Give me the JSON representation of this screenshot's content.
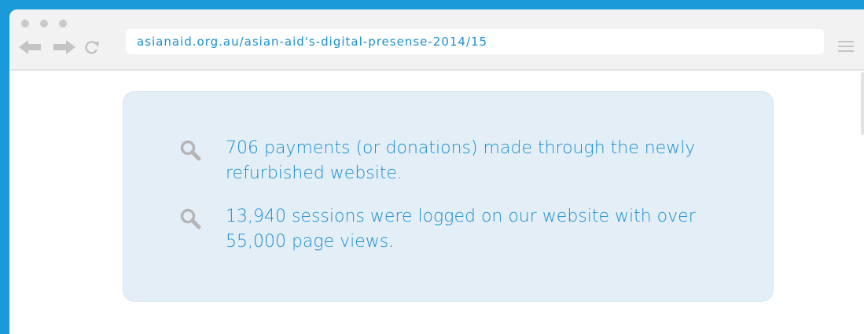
{
  "browser": {
    "url": "asianaid.org.au/asian-aid's-digital-presense-2014/15"
  },
  "content": {
    "items": [
      {
        "icon": "search-icon",
        "text": "706 payments (or donations) made through the newly refurbished website.",
        "suffix": ""
      },
      {
        "icon": "search-icon",
        "text": "13,940 sessions were logged on our website with over 55,000 page views",
        "suffix": "."
      }
    ]
  },
  "colors": {
    "frame": "#1a9ad9",
    "text": "#1b8fd0",
    "card": "#e3eef7",
    "chrome": "#f2f2f2",
    "icon": "#b5b5b5"
  }
}
